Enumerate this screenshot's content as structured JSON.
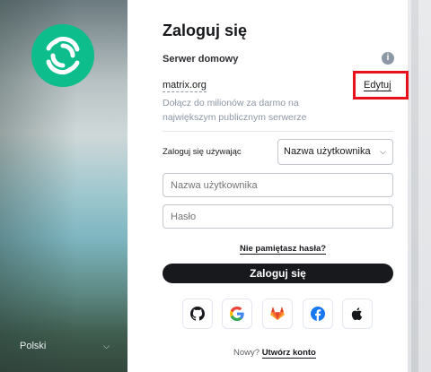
{
  "sidebar": {
    "language": "Polski"
  },
  "login": {
    "title": "Zaloguj się",
    "server_heading": "Serwer domowy",
    "server_name": "matrix.org",
    "server_description": "Dołącz do milionów za darmo na największym publicznym serwerze",
    "edit_label": "Edytuj",
    "login_using_label": "Zaloguj się używając",
    "login_method_selected": "Nazwa użytkownika",
    "username_placeholder": "Nazwa użytkownika",
    "password_placeholder": "Hasło",
    "forgot_password": "Nie pamiętasz hasła?",
    "submit_label": "Zaloguj się",
    "sso_providers": [
      "github-icon",
      "google-icon",
      "gitlab-icon",
      "facebook-icon",
      "apple-icon"
    ],
    "signup_prompt": "Nowy?",
    "signup_link": "Utwórz konto"
  },
  "colors": {
    "brand": "#0dbd8b",
    "highlight_box": "#e8101a",
    "button": "#17191c"
  }
}
